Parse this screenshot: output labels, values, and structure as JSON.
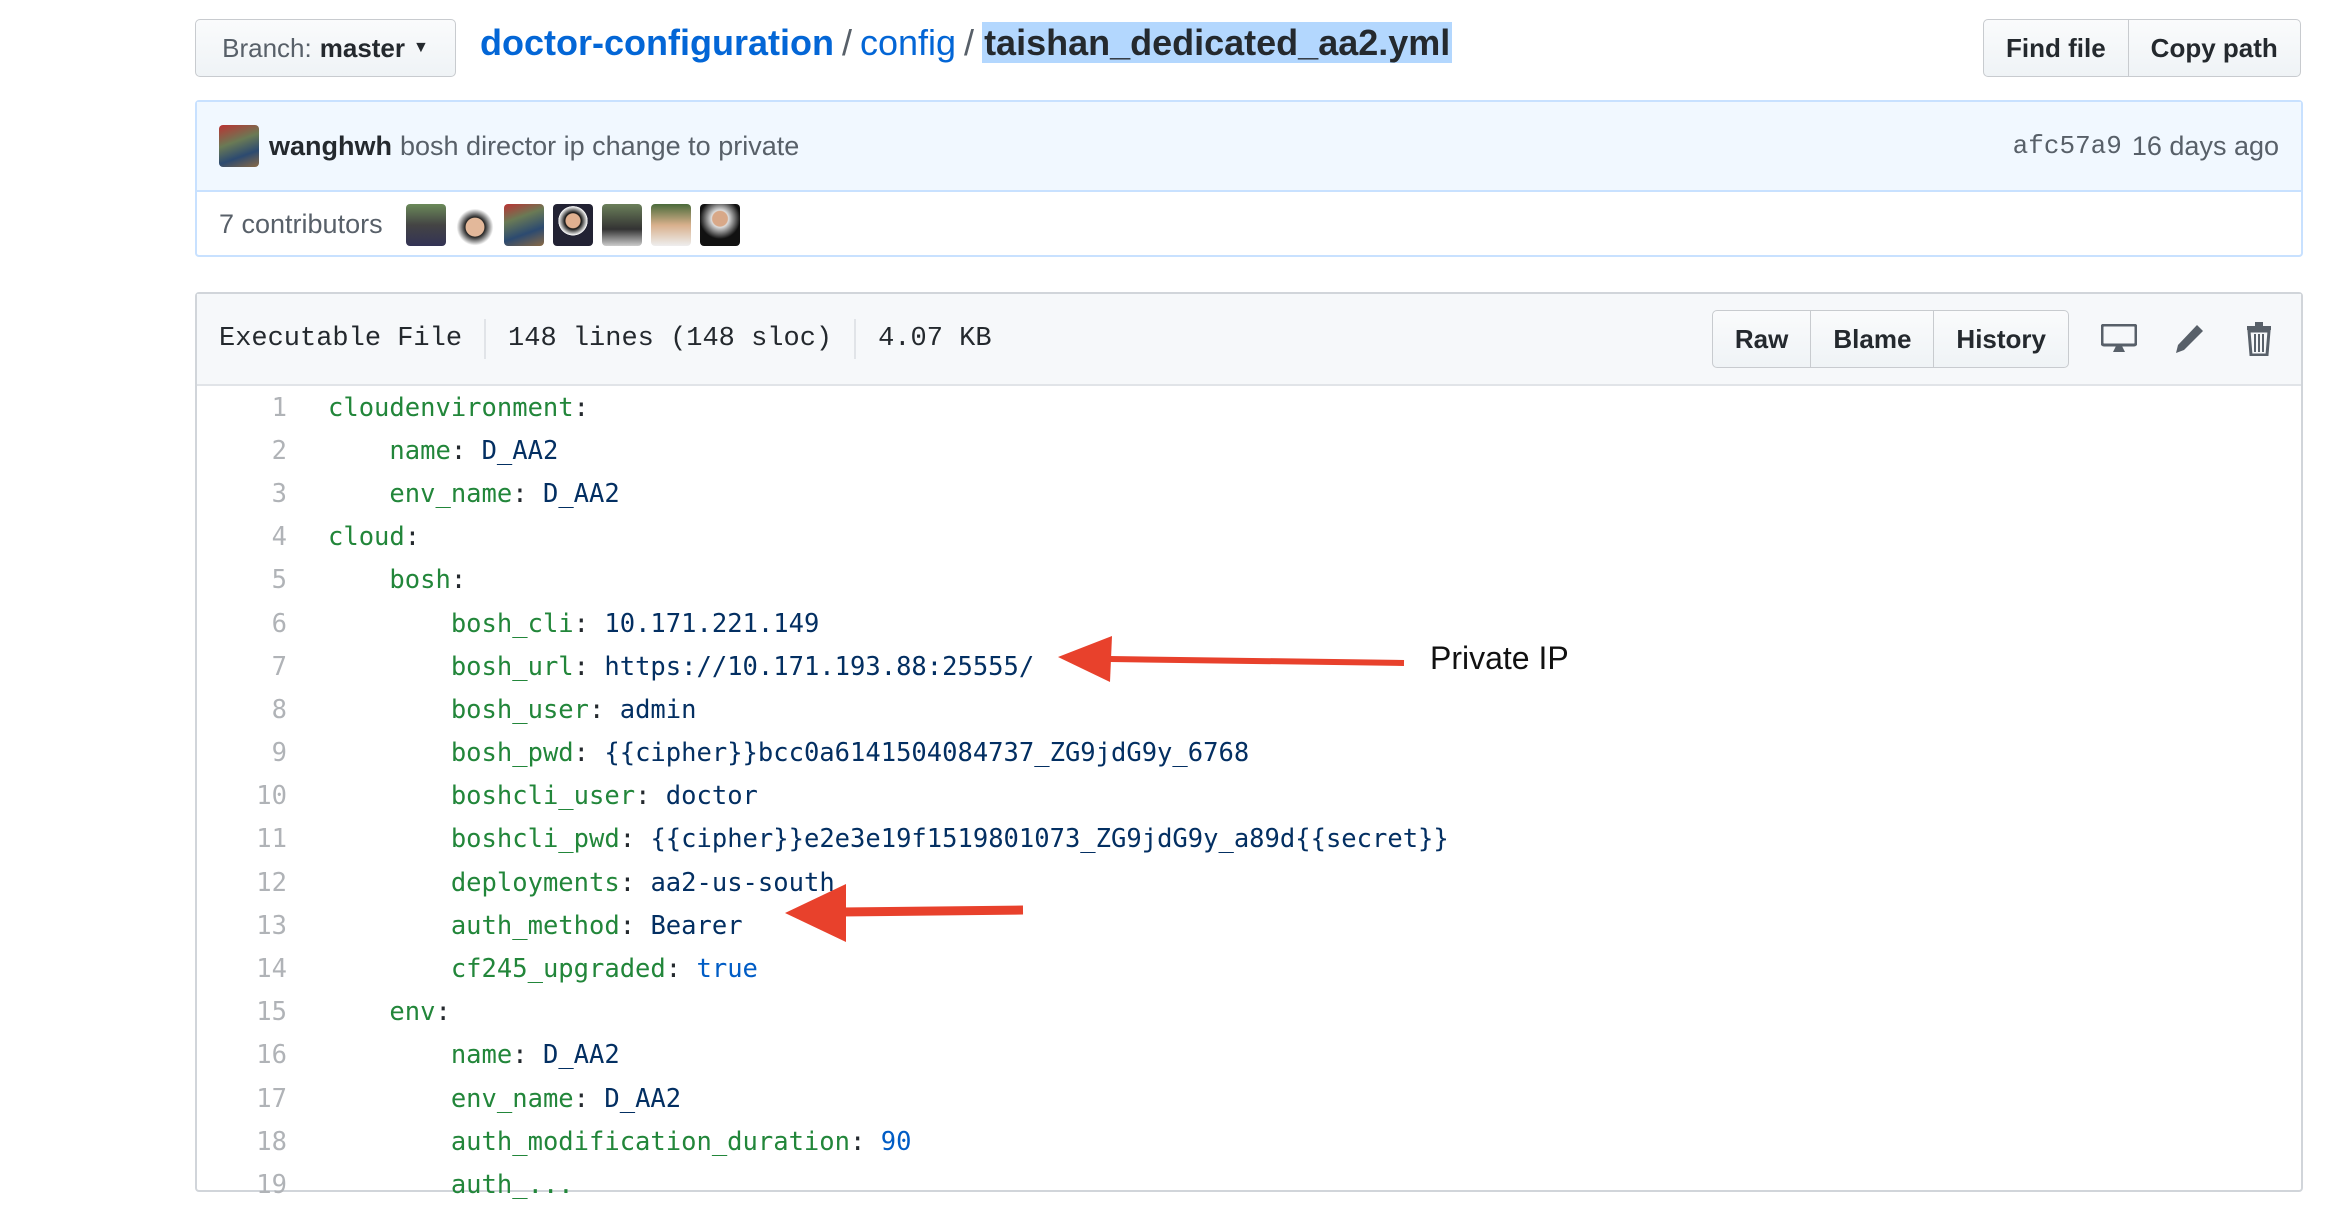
{
  "branch": {
    "label": "Branch:",
    "value": "master"
  },
  "breadcrumb": {
    "root": "doctor-configuration",
    "folder": "config",
    "file": "taishan_dedicated_aa2.yml",
    "separator": "/"
  },
  "actions": {
    "find_file": "Find file",
    "copy_path": "Copy path"
  },
  "commit": {
    "author": "wanghwh",
    "message": "bosh director ip change to private",
    "sha": "afc57a9",
    "age": "16 days ago"
  },
  "contributors": {
    "label": "7 contributors",
    "count": 7
  },
  "file": {
    "mode": "Executable File",
    "lines": "148 lines (148 sloc)",
    "size": "4.07 KB",
    "raw": "Raw",
    "blame": "Blame",
    "history": "History"
  },
  "code": [
    {
      "n": "1",
      "indent": 0,
      "key": "cloudenvironment",
      "val": "",
      "type": ""
    },
    {
      "n": "2",
      "indent": 1,
      "key": "name",
      "val": "D_AA2",
      "type": "v"
    },
    {
      "n": "3",
      "indent": 1,
      "key": "env_name",
      "val": "D_AA2",
      "type": "v"
    },
    {
      "n": "4",
      "indent": 0,
      "key": "cloud",
      "val": "",
      "type": ""
    },
    {
      "n": "5",
      "indent": 1,
      "key": "bosh",
      "val": "",
      "type": ""
    },
    {
      "n": "6",
      "indent": 2,
      "key": "bosh_cli",
      "val": "10.171.221.149",
      "type": "v"
    },
    {
      "n": "7",
      "indent": 2,
      "key": "bosh_url",
      "val": "https://10.171.193.88:25555/",
      "type": "v"
    },
    {
      "n": "8",
      "indent": 2,
      "key": "bosh_user",
      "val": "admin",
      "type": "v"
    },
    {
      "n": "9",
      "indent": 2,
      "key": "bosh_pwd",
      "val": "{{cipher}}bcc0a6141504084737_ZG9jdG9y_6768",
      "type": "v"
    },
    {
      "n": "10",
      "indent": 2,
      "key": "boshcli_user",
      "val": "doctor",
      "type": "v"
    },
    {
      "n": "11",
      "indent": 2,
      "key": "boshcli_pwd",
      "val": "{{cipher}}e2e3e19f1519801073_ZG9jdG9y_a89d{{secret}}",
      "type": "v"
    },
    {
      "n": "12",
      "indent": 2,
      "key": "deployments",
      "val": "aa2-us-south",
      "type": "v"
    },
    {
      "n": "13",
      "indent": 2,
      "key": "auth_method",
      "val": "Bearer",
      "type": "v"
    },
    {
      "n": "14",
      "indent": 2,
      "key": "cf245_upgraded",
      "val": "true",
      "type": "n"
    },
    {
      "n": "15",
      "indent": 1,
      "key": "env",
      "val": "",
      "type": ""
    },
    {
      "n": "16",
      "indent": 2,
      "key": "name",
      "val": "D_AA2",
      "type": "v"
    },
    {
      "n": "17",
      "indent": 2,
      "key": "env_name",
      "val": "D_AA2",
      "type": "v"
    },
    {
      "n": "18",
      "indent": 2,
      "key": "auth_modification_duration",
      "val": "90",
      "type": "n"
    },
    {
      "n": "19",
      "indent": 2,
      "key": "auth_...",
      "val": "",
      "type": ""
    }
  ],
  "annotations": {
    "private_ip": "Private IP",
    "arrow_color": "#e8412c"
  }
}
